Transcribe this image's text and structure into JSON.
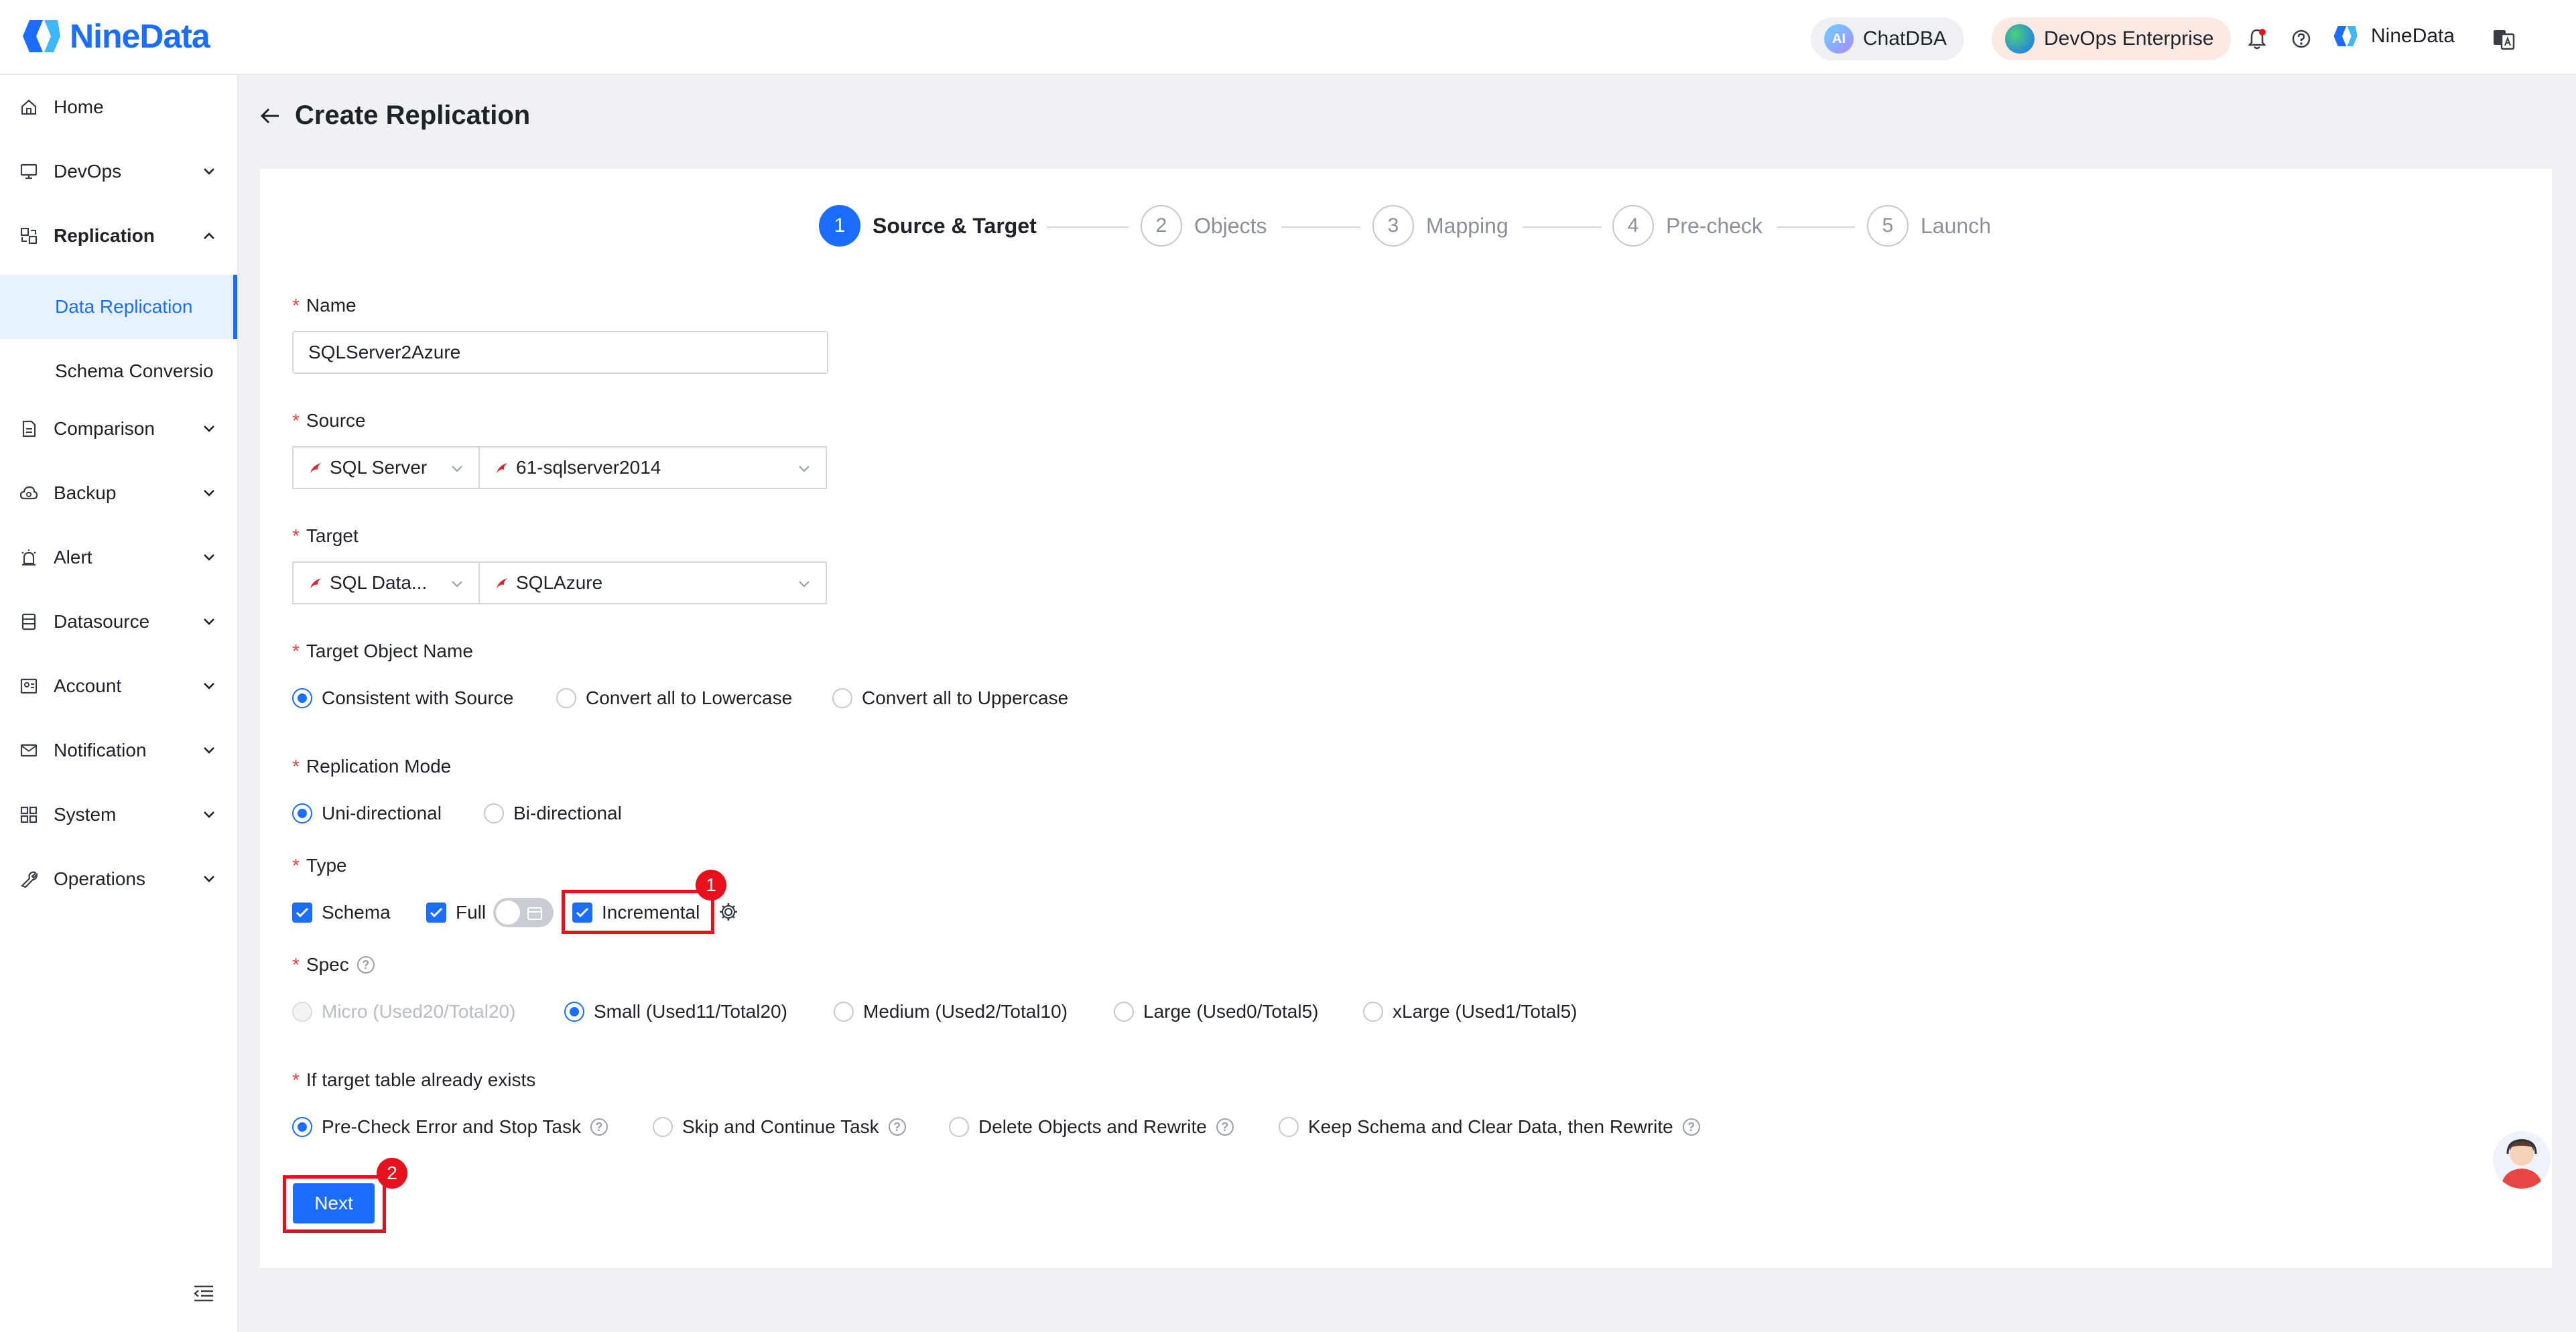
{
  "header": {
    "logo_text": "NineData",
    "chatdba_label": "ChatDBA",
    "chatdba_badge": "AI",
    "devops_label": "DevOps Enterprise",
    "user_label": "NineData"
  },
  "sidebar": {
    "items": [
      {
        "label": "Home",
        "icon": "home-icon"
      },
      {
        "label": "DevOps",
        "icon": "monitor-icon"
      },
      {
        "label": "Replication",
        "icon": "replication-icon"
      },
      {
        "label": "Comparison",
        "icon": "document-icon"
      },
      {
        "label": "Backup",
        "icon": "cloud-icon"
      },
      {
        "label": "Alert",
        "icon": "alarm-icon"
      },
      {
        "label": "Datasource",
        "icon": "database-icon"
      },
      {
        "label": "Account",
        "icon": "account-icon"
      },
      {
        "label": "Notification",
        "icon": "mail-icon"
      },
      {
        "label": "System",
        "icon": "grid-icon"
      },
      {
        "label": "Operations",
        "icon": "wrench-icon"
      }
    ],
    "sub_items": [
      {
        "label": "Data Replication"
      },
      {
        "label": "Schema Conversio"
      }
    ]
  },
  "page": {
    "title": "Create Replication"
  },
  "steps": [
    {
      "num": "1",
      "label": "Source & Target"
    },
    {
      "num": "2",
      "label": "Objects"
    },
    {
      "num": "3",
      "label": "Mapping"
    },
    {
      "num": "4",
      "label": "Pre-check"
    },
    {
      "num": "5",
      "label": "Launch"
    }
  ],
  "form": {
    "name_label": "Name",
    "name_value": "SQLServer2Azure",
    "source_label": "Source",
    "source_type": "SQL Server",
    "source_instance": "61-sqlserver2014",
    "target_label": "Target",
    "target_type": "SQL Data...",
    "target_instance": "SQLAzure",
    "target_object_name_label": "Target Object Name",
    "target_object_name_options": [
      "Consistent with Source",
      "Convert all to Lowercase",
      "Convert all to Uppercase"
    ],
    "replication_mode_label": "Replication Mode",
    "replication_mode_options": [
      "Uni-directional",
      "Bi-directional"
    ],
    "type_label": "Type",
    "type_options": [
      "Schema",
      "Full",
      "Incremental"
    ],
    "spec_label": "Spec",
    "spec_options": [
      "Micro (Used20/Total20)",
      "Small (Used11/Total20)",
      "Medium (Used2/Total10)",
      "Large (Used0/Total5)",
      "xLarge (Used1/Total5)"
    ],
    "exists_label": "If target table already exists",
    "exists_options": [
      "Pre-Check Error and Stop Task",
      "Skip and Continue Task",
      "Delete Objects and Rewrite",
      "Keep Schema and Clear Data, then Rewrite"
    ],
    "next_label": "Next",
    "required_mark": "*"
  },
  "annotations": {
    "badge1": "1",
    "badge2": "2"
  },
  "colors": {
    "accent": "#1a6dff",
    "annotation": "#e8101c"
  }
}
